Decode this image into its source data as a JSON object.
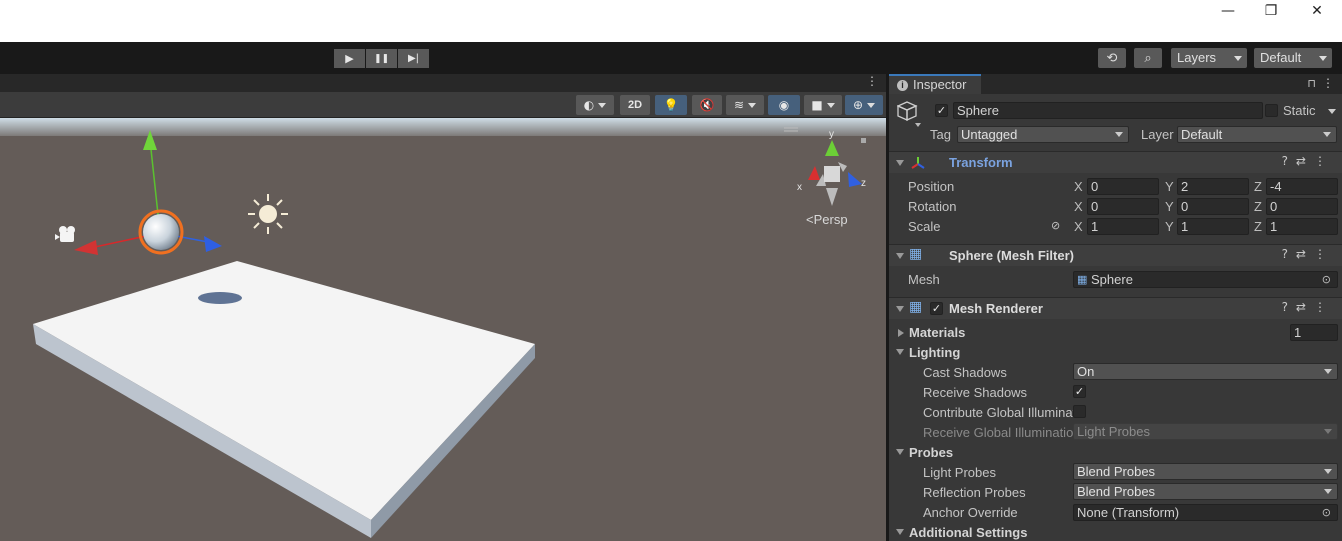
{
  "window_controls": {
    "minimize": "—",
    "maximize": "❐",
    "close": "✕"
  },
  "toolbar": {
    "play_icon": "▶",
    "pause_icon": "❚❚",
    "step_icon": "▶|",
    "history_icon": "⟲",
    "search_icon": "⌕",
    "layers_label": "Layers",
    "layout_label": "Default"
  },
  "scene": {
    "kebab": "⋮",
    "toolbar": {
      "mode_2d": "2D"
    },
    "persp_label": "Persp",
    "gizmo_axes": {
      "x": "x",
      "y": "y",
      "z": "z"
    }
  },
  "inspector": {
    "tab_label": "Inspector",
    "lock_icon": "🔒",
    "kebab": "⋮",
    "object": {
      "name": "Sphere",
      "active_check": "✓",
      "static_label": "Static",
      "tag_label": "Tag",
      "tag_value": "Untagged",
      "layer_label": "Layer",
      "layer_value": "Default"
    },
    "transform": {
      "title": "Transform",
      "position_label": "Position",
      "rotation_label": "Rotation",
      "scale_label": "Scale",
      "axis_x": "X",
      "axis_y": "Y",
      "axis_z": "Z",
      "position": {
        "x": "0",
        "y": "2",
        "z": "-4"
      },
      "rotation": {
        "x": "0",
        "y": "0",
        "z": "0"
      },
      "scale": {
        "x": "1",
        "y": "1",
        "z": "1"
      }
    },
    "mesh_filter": {
      "title": "Sphere (Mesh Filter)",
      "mesh_label": "Mesh",
      "mesh_value": "Sphere"
    },
    "mesh_renderer": {
      "title": "Mesh Renderer",
      "enabled_check": "✓",
      "materials_label": "Materials",
      "materials_count": "1",
      "lighting_label": "Lighting",
      "cast_shadows_label": "Cast Shadows",
      "cast_shadows_value": "On",
      "receive_shadows_label": "Receive Shadows",
      "receive_shadows_check": "✓",
      "contribute_gi_label": "Contribute Global Illuminat",
      "receive_gi_label": "Receive Global Illuminatior",
      "receive_gi_value": "Light Probes",
      "probes_label": "Probes",
      "light_probes_label": "Light Probes",
      "light_probes_value": "Blend Probes",
      "reflection_probes_label": "Reflection Probes",
      "reflection_probes_value": "Blend Probes",
      "anchor_override_label": "Anchor Override",
      "anchor_override_value": "None (Transform)",
      "additional_settings_label": "Additional Settings"
    },
    "header_icons": "?⇄⋮"
  },
  "colors": {
    "accent": "#3a79bb",
    "panel": "#383838",
    "toolbar": "#191919",
    "selection_outline": "#f07020"
  }
}
